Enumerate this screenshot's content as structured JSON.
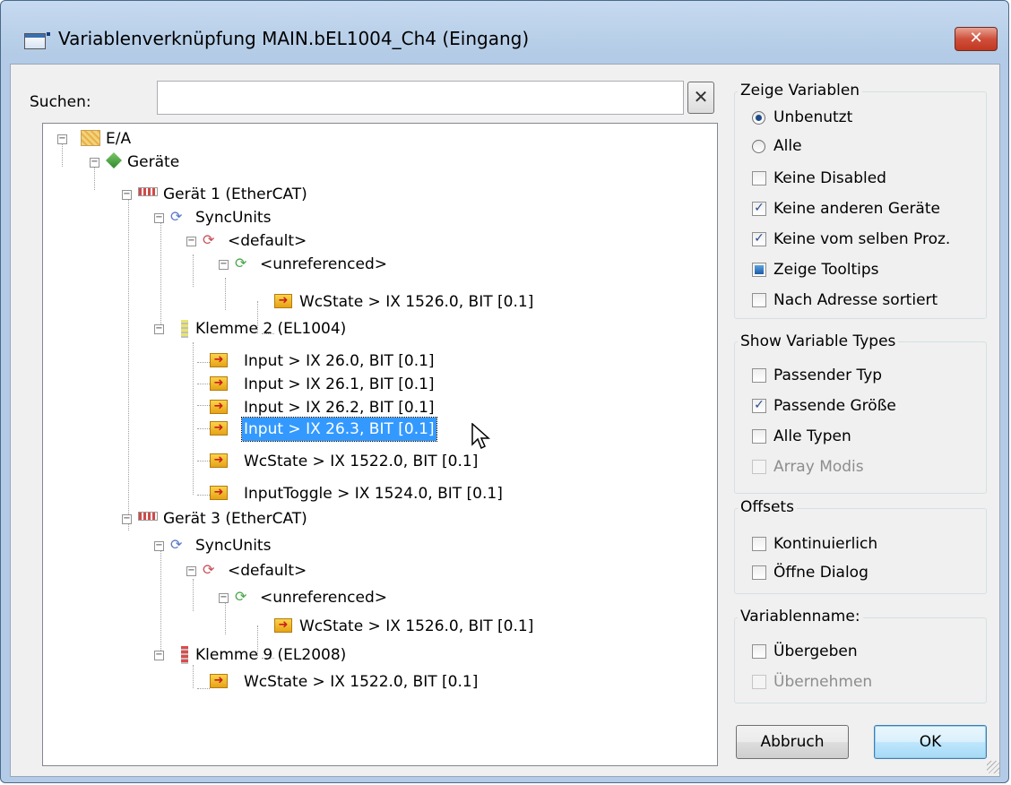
{
  "window": {
    "title": "Variablenverknüpfung MAIN.bEL1004_Ch4 (Eingang)",
    "close_label": "✕"
  },
  "search": {
    "label": "Suchen:",
    "value": "",
    "placeholder": "",
    "clear_label": "✕"
  },
  "tree": {
    "nodes": [
      {
        "label": "E/A"
      },
      {
        "label": "Geräte"
      },
      {
        "label": "Gerät 1 (EtherCAT)"
      },
      {
        "label": "SyncUnits"
      },
      {
        "label": "<default>"
      },
      {
        "label": "<unreferenced>"
      },
      {
        "label": "WcState   >   IX 1526.0, BIT [0.1]"
      },
      {
        "label": "Klemme 2 (EL1004)"
      },
      {
        "label": "Input   >   IX 26.0, BIT [0.1]"
      },
      {
        "label": "Input   >   IX 26.1, BIT [0.1]"
      },
      {
        "label": "Input   >   IX 26.2, BIT [0.1]"
      },
      {
        "label": "Input   >   IX 26.3, BIT [0.1]"
      },
      {
        "label": "WcState   >   IX 1522.0, BIT [0.1]"
      },
      {
        "label": "InputToggle   >   IX 1524.0, BIT [0.1]"
      },
      {
        "label": "Gerät 3 (EtherCAT)"
      },
      {
        "label": "SyncUnits"
      },
      {
        "label": "<default>"
      },
      {
        "label": "<unreferenced>"
      },
      {
        "label": "WcState   >   IX 1526.0, BIT [0.1]"
      },
      {
        "label": "Klemme 9 (EL2008)"
      },
      {
        "label": "WcState   >   IX 1522.0, BIT [0.1]"
      }
    ],
    "selected_label": "Input   >   IX 26.3, BIT [0.1]"
  },
  "show_variables": {
    "title": "Zeige Variablen",
    "radios": [
      {
        "label": "Unbenutzt",
        "checked": true
      },
      {
        "label": "Alle",
        "checked": false
      }
    ],
    "checks": [
      {
        "label": "Keine Disabled",
        "checked": false
      },
      {
        "label": "Keine anderen Geräte",
        "checked": true
      },
      {
        "label": "Keine vom selben Proz.",
        "checked": true
      },
      {
        "label": "Zeige Tooltips",
        "state": "indeterminate"
      },
      {
        "label": "Nach Adresse sortiert",
        "checked": false
      }
    ]
  },
  "show_types": {
    "title": "Show Variable Types",
    "checks": [
      {
        "label": "Passender Typ",
        "checked": false
      },
      {
        "label": "Passende Größe",
        "checked": true
      },
      {
        "label": "Alle Typen",
        "checked": false
      },
      {
        "label": "Array Modis",
        "checked": false,
        "disabled": true
      }
    ]
  },
  "offsets": {
    "title": "Offsets",
    "checks": [
      {
        "label": "Kontinuierlich",
        "checked": false
      },
      {
        "label": "Öffne Dialog",
        "checked": false
      }
    ]
  },
  "varname": {
    "title": "Variablenname:",
    "checks": [
      {
        "label": "Übergeben",
        "checked": false
      },
      {
        "label": "Übernehmen",
        "checked": false,
        "disabled": true
      }
    ]
  },
  "buttons": {
    "cancel": "Abbruch",
    "ok": "OK"
  },
  "colors": {
    "selection": "#3399ff",
    "titlebar": "#b3cbe6",
    "close": "#c2381f"
  }
}
